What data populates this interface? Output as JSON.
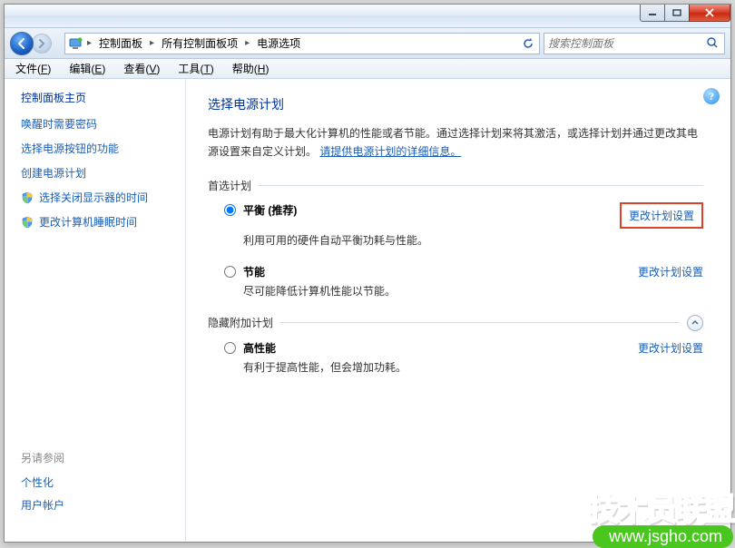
{
  "window": {
    "minimize_label": "最小化",
    "maximize_label": "最大化",
    "close_label": "关闭"
  },
  "breadcrumb": {
    "items": [
      "控制面板",
      "所有控制面板项",
      "电源选项"
    ]
  },
  "search": {
    "placeholder": "搜索控制面板"
  },
  "menubar": {
    "items": [
      {
        "label": "文件",
        "accel": "F"
      },
      {
        "label": "编辑",
        "accel": "E"
      },
      {
        "label": "查看",
        "accel": "V"
      },
      {
        "label": "工具",
        "accel": "T"
      },
      {
        "label": "帮助",
        "accel": "H"
      }
    ]
  },
  "sidebar": {
    "home": "控制面板主页",
    "links": [
      {
        "label": "唤醒时需要密码",
        "icon": ""
      },
      {
        "label": "选择电源按钮的功能",
        "icon": ""
      },
      {
        "label": "创建电源计划",
        "icon": ""
      },
      {
        "label": "选择关闭显示器的时间",
        "icon": "monitor"
      },
      {
        "label": "更改计算机睡眠时间",
        "icon": "moon"
      }
    ],
    "see_also_title": "另请参阅",
    "see_also": [
      "个性化",
      "用户帐户"
    ]
  },
  "content": {
    "heading": "选择电源计划",
    "description_pre": "电源计划有助于最大化计算机的性能或者节能。通过选择计划来将其激活，或选择计划并通过更改其电源设置来自定义计划。",
    "description_link": "请提供电源计划的详细信息。",
    "section_preferred": "首选计划",
    "section_hidden": "隐藏附加计划",
    "change_link_label": "更改计划设置",
    "plans_preferred": [
      {
        "name": "平衡 (推荐)",
        "desc": "利用可用的硬件自动平衡功耗与性能。",
        "selected": true,
        "highlighted": true
      },
      {
        "name": "节能",
        "desc": "尽可能降低计算机性能以节能。",
        "selected": false,
        "highlighted": false
      }
    ],
    "plans_hidden": [
      {
        "name": "高性能",
        "desc": "有利于提高性能，但会增加功耗。",
        "selected": false,
        "highlighted": false
      }
    ]
  },
  "watermark": {
    "line1": "技术员联盟",
    "line2": "www.jsgho.com"
  }
}
